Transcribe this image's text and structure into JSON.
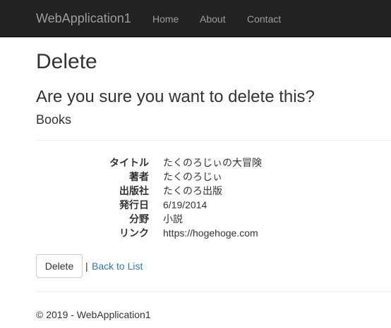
{
  "navbar": {
    "brand": "WebApplication1",
    "links": [
      {
        "label": "Home"
      },
      {
        "label": "About"
      },
      {
        "label": "Contact"
      }
    ]
  },
  "main": {
    "title": "Delete",
    "confirm_text": "Are you sure you want to delete this?",
    "entity_name": "Books",
    "details": [
      {
        "label": "タイトル",
        "value": "たくのろじぃの大冒険"
      },
      {
        "label": "著者",
        "value": "たくのろじぃ"
      },
      {
        "label": "出版社",
        "value": "たくのろ出版"
      },
      {
        "label": "発行日",
        "value": "6/19/2014"
      },
      {
        "label": "分野",
        "value": "小説"
      },
      {
        "label": "リンク",
        "value": "https://hogehoge.com"
      }
    ],
    "delete_button_label": "Delete",
    "separator": "|",
    "back_link_label": "Back to List"
  },
  "footer": {
    "text": "© 2019 - WebApplication1"
  },
  "colors": {
    "navbar_bg": "#222222",
    "navbar_text": "#9d9d9d",
    "link": "#337ab7",
    "text": "#333333"
  }
}
